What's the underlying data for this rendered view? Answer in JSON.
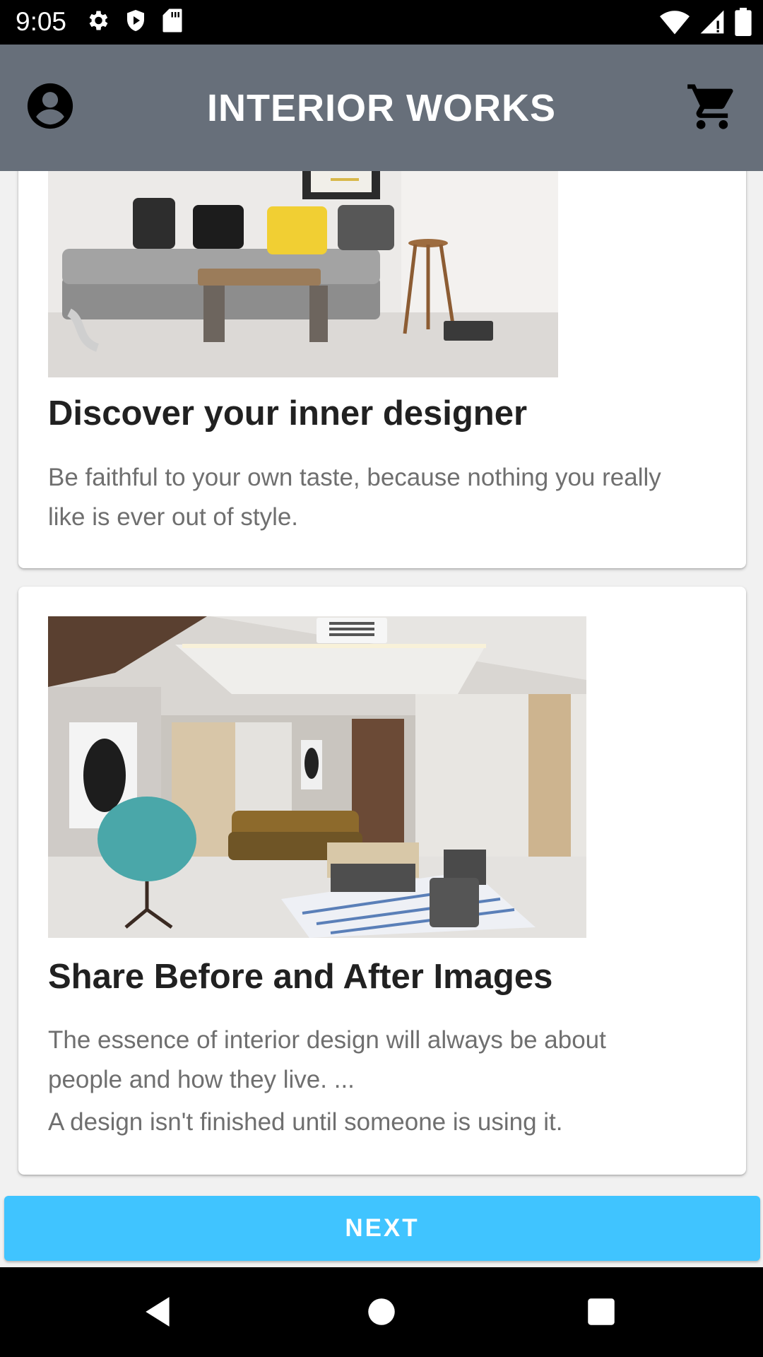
{
  "status_bar": {
    "time": "9:05",
    "left_icons": [
      "settings-icon",
      "play-protect-icon",
      "sd-card-icon"
    ],
    "right_icons": [
      "wifi-icon",
      "signal-icon",
      "battery-icon"
    ]
  },
  "app_bar": {
    "title": "INTERIOR WORKS",
    "left_icon": "account-circle-icon",
    "right_icon": "shopping-cart-icon",
    "background": "#676f7a"
  },
  "cards": [
    {
      "image": "living-room-sofa-photo",
      "title": "Discover your inner designer",
      "body_lines": [
        "Be faithful to your own taste, because nothing you really",
        "like is ever out of style."
      ]
    },
    {
      "image": "modern-living-room-photo",
      "title": "Share Before and After Images",
      "body_lines": [
        "The essence of interior design will always be about",
        "people and how they live. ...",
        "A design isn't finished until someone is using it."
      ]
    }
  ],
  "next_button": {
    "label": "NEXT",
    "color": "#40c4ff"
  },
  "nav_bar": {
    "buttons": [
      "back-icon",
      "home-icon",
      "recents-icon"
    ]
  }
}
